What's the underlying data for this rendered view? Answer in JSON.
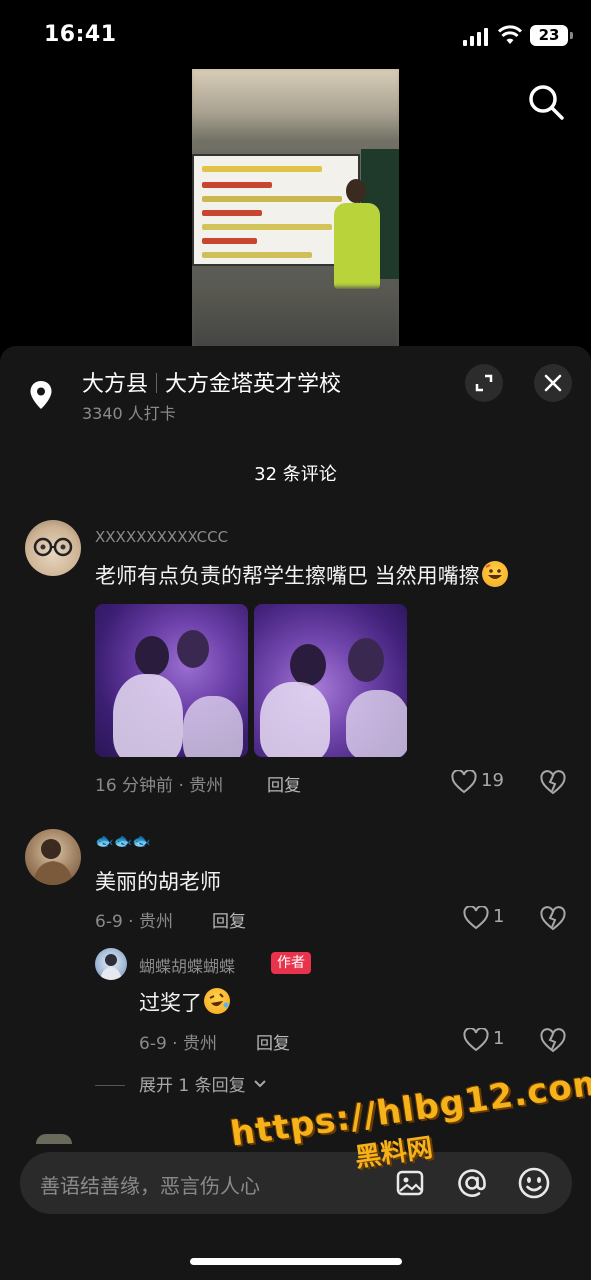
{
  "status": {
    "time": "16:41",
    "battery": "23"
  },
  "location": {
    "county": "大方县",
    "school": "大方金塔英才学校",
    "checkins": "3340 人打卡"
  },
  "comment_count": "32 条评论",
  "comments": [
    {
      "username": "XXXXXXXXXXCCC",
      "text": "老师有点负责的帮学生擦嘴巴 当然用嘴擦",
      "meta": "16 分钟前 · 贵州",
      "reply": "回复",
      "likes": "19"
    },
    {
      "username": "🐟🐟🐟",
      "text": "美丽的胡老师",
      "meta": "6-9 · 贵州",
      "reply": "回复",
      "likes": "1"
    }
  ],
  "reply": {
    "username": "蝴蝶胡蝶蝴蝶",
    "badge": "作者",
    "text": "过奖了",
    "meta": "6-9 · 贵州",
    "reply": "回复",
    "likes": "1"
  },
  "expand_replies": "展开 1 条回复",
  "input": {
    "placeholder": "善语结善缘，恶言伤人心"
  },
  "watermark": {
    "url": "https://hlbg12.com",
    "name": "黑料网"
  },
  "colors": {
    "sheet_bg": "#161616",
    "author_badge": "#e9324b",
    "watermark": "#f6b21a"
  }
}
